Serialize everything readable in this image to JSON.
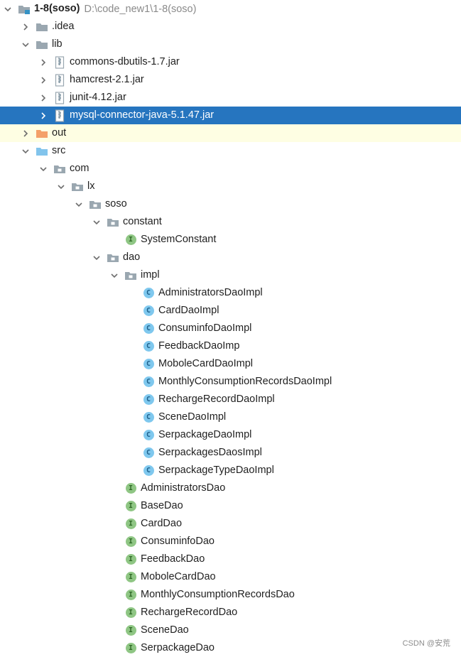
{
  "tree": [
    {
      "label": "1-8(soso)",
      "path": "D:\\code_new1\\1-8(soso)",
      "depth": 0,
      "expand": "open",
      "icon": "module-folder-icon",
      "root": true
    },
    {
      "label": ".idea",
      "depth": 1,
      "expand": "closed",
      "icon": "folder-icon"
    },
    {
      "label": "lib",
      "depth": 1,
      "expand": "open",
      "icon": "folder-icon"
    },
    {
      "label": "commons-dbutils-1.7.jar",
      "depth": 2,
      "expand": "closed",
      "icon": "jar-icon"
    },
    {
      "label": "hamcrest-2.1.jar",
      "depth": 2,
      "expand": "closed",
      "icon": "jar-icon"
    },
    {
      "label": "junit-4.12.jar",
      "depth": 2,
      "expand": "closed",
      "icon": "jar-icon"
    },
    {
      "label": "mysql-connector-java-5.1.47.jar",
      "depth": 2,
      "expand": "closed",
      "icon": "jar-icon",
      "selected": true
    },
    {
      "label": "out",
      "depth": 1,
      "expand": "closed",
      "icon": "excluded-folder-icon",
      "highlight": true
    },
    {
      "label": "src",
      "depth": 1,
      "expand": "open",
      "icon": "source-folder-icon"
    },
    {
      "label": "com",
      "depth": 2,
      "expand": "open",
      "icon": "package-icon"
    },
    {
      "label": "lx",
      "depth": 3,
      "expand": "open",
      "icon": "package-icon"
    },
    {
      "label": "soso",
      "depth": 4,
      "expand": "open",
      "icon": "package-icon"
    },
    {
      "label": "constant",
      "depth": 5,
      "expand": "open",
      "icon": "package-icon"
    },
    {
      "label": "SystemConstant",
      "depth": 6,
      "expand": "none",
      "icon": "interface-icon"
    },
    {
      "label": "dao",
      "depth": 5,
      "expand": "open",
      "icon": "package-icon"
    },
    {
      "label": "impl",
      "depth": 6,
      "expand": "open",
      "icon": "package-icon"
    },
    {
      "label": "AdministratorsDaoImpl",
      "depth": 7,
      "expand": "none",
      "icon": "class-icon"
    },
    {
      "label": "CardDaoImpl",
      "depth": 7,
      "expand": "none",
      "icon": "class-icon"
    },
    {
      "label": "ConsuminfoDaoImpl",
      "depth": 7,
      "expand": "none",
      "icon": "class-icon"
    },
    {
      "label": "FeedbackDaoImp",
      "depth": 7,
      "expand": "none",
      "icon": "class-icon"
    },
    {
      "label": "MoboleCardDaoImpl",
      "depth": 7,
      "expand": "none",
      "icon": "class-icon"
    },
    {
      "label": "MonthlyConsumptionRecordsDaoImpl",
      "depth": 7,
      "expand": "none",
      "icon": "class-icon"
    },
    {
      "label": "RechargeRecordDaoImpl",
      "depth": 7,
      "expand": "none",
      "icon": "class-icon"
    },
    {
      "label": "SceneDaoImpl",
      "depth": 7,
      "expand": "none",
      "icon": "class-icon"
    },
    {
      "label": "SerpackageDaoImpl",
      "depth": 7,
      "expand": "none",
      "icon": "class-icon"
    },
    {
      "label": "SerpackagesDaosImpl",
      "depth": 7,
      "expand": "none",
      "icon": "class-icon"
    },
    {
      "label": "SerpackageTypeDaoImpl",
      "depth": 7,
      "expand": "none",
      "icon": "class-icon"
    },
    {
      "label": "AdministratorsDao",
      "depth": 6,
      "expand": "none",
      "icon": "interface-icon"
    },
    {
      "label": "BaseDao",
      "depth": 6,
      "expand": "none",
      "icon": "interface-icon"
    },
    {
      "label": "CardDao",
      "depth": 6,
      "expand": "none",
      "icon": "interface-icon"
    },
    {
      "label": "ConsuminfoDao",
      "depth": 6,
      "expand": "none",
      "icon": "interface-icon"
    },
    {
      "label": "FeedbackDao",
      "depth": 6,
      "expand": "none",
      "icon": "interface-icon"
    },
    {
      "label": "MoboleCardDao",
      "depth": 6,
      "expand": "none",
      "icon": "interface-icon"
    },
    {
      "label": "MonthlyConsumptionRecordsDao",
      "depth": 6,
      "expand": "none",
      "icon": "interface-icon"
    },
    {
      "label": "RechargeRecordDao",
      "depth": 6,
      "expand": "none",
      "icon": "interface-icon"
    },
    {
      "label": "SceneDao",
      "depth": 6,
      "expand": "none",
      "icon": "interface-icon"
    },
    {
      "label": "SerpackageDao",
      "depth": 6,
      "expand": "none",
      "icon": "interface-icon"
    }
  ],
  "badges": {
    "interface": "I",
    "class": "C"
  },
  "colors": {
    "selection": "#2675bf",
    "highlight_row": "#fefee3",
    "folder": "#9aa7b0",
    "excluded_folder": "#f4a069",
    "source_folder": "#82c4ec",
    "interface_badge": "#8fc684",
    "class_badge": "#7fc8ee"
  },
  "watermark": "CSDN @安荒"
}
